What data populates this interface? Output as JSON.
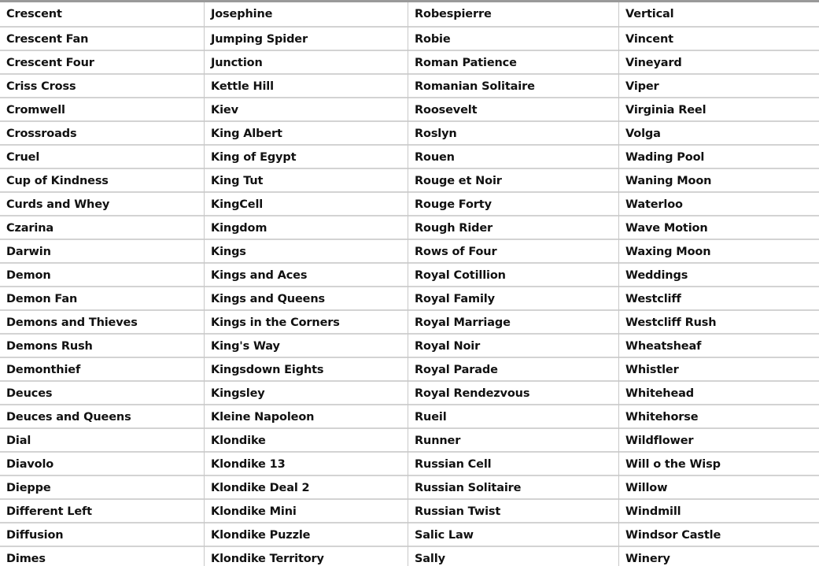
{
  "table": {
    "row_count": 24,
    "column_count": 4,
    "border_color": "#d3d3d3",
    "top_border_color": "#9a9a9a",
    "text_color": "#111111",
    "background_color": "#ffffff",
    "columns": [
      {
        "name": "column-1",
        "items": [
          "Crescent",
          "Crescent Fan",
          "Crescent Four",
          "Criss Cross",
          "Cromwell",
          "Crossroads",
          "Cruel",
          "Cup of Kindness",
          "Curds and Whey",
          "Czarina",
          "Darwin",
          "Demon",
          "Demon Fan",
          "Demons and Thieves",
          "Demons Rush",
          "Demonthief",
          "Deuces",
          "Deuces and Queens",
          "Dial",
          "Diavolo",
          "Dieppe",
          "Different Left",
          "Diffusion",
          "Dimes"
        ]
      },
      {
        "name": "column-2",
        "items": [
          "Josephine",
          "Jumping Spider",
          "Junction",
          "Kettle Hill",
          "Kiev",
          "King Albert",
          "King of Egypt",
          "King Tut",
          "KingCell",
          "Kingdom",
          "Kings",
          "Kings and Aces",
          "Kings and Queens",
          "Kings in the Corners",
          "King's Way",
          "Kingsdown Eights",
          "Kingsley",
          "Kleine Napoleon",
          "Klondike",
          "Klondike 13",
          "Klondike Deal 2",
          "Klondike Mini",
          "Klondike Puzzle",
          "Klondike Territory"
        ]
      },
      {
        "name": "column-3",
        "items": [
          "Robespierre",
          "Robie",
          "Roman Patience",
          "Romanian Solitaire",
          "Roosevelt",
          "Roslyn",
          "Rouen",
          "Rouge et Noir",
          "Rouge Forty",
          "Rough Rider",
          "Rows of Four",
          "Royal Cotillion",
          "Royal Family",
          "Royal Marriage",
          "Royal Noir",
          "Royal Parade",
          "Royal Rendezvous",
          "Rueil",
          "Runner",
          "Russian Cell",
          "Russian Solitaire",
          "Russian Twist",
          "Salic Law",
          "Sally"
        ]
      },
      {
        "name": "column-4",
        "items": [
          "Vertical",
          "Vincent",
          "Vineyard",
          "Viper",
          "Virginia Reel",
          "Volga",
          "Wading Pool",
          "Waning Moon",
          "Waterloo",
          "Wave Motion",
          "Waxing Moon",
          "Weddings",
          "Westcliff",
          "Westcliff Rush",
          "Wheatsheaf",
          "Whistler",
          "Whitehead",
          "Whitehorse",
          "Wildflower",
          "Will o the Wisp",
          "Willow",
          "Windmill",
          "Windsor Castle",
          "Winery"
        ]
      }
    ]
  }
}
